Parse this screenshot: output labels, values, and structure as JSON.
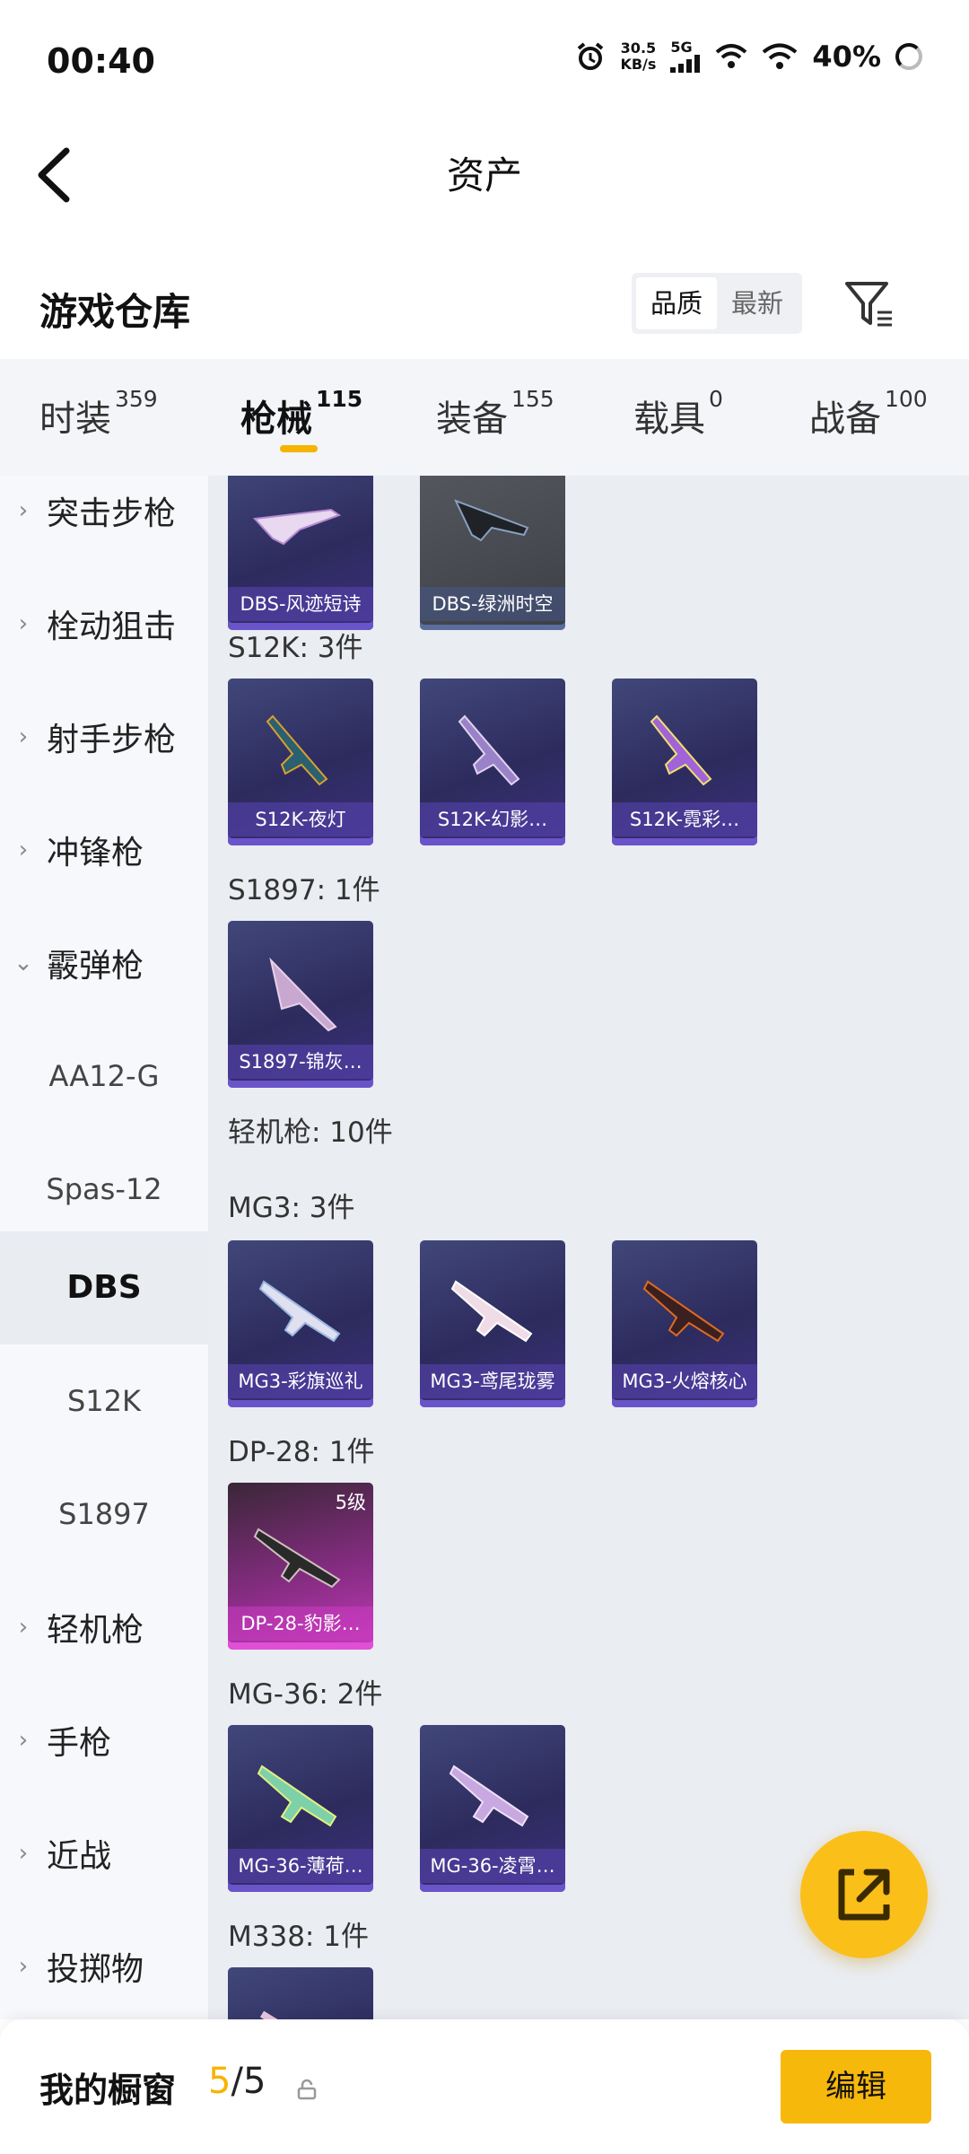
{
  "status_bar": {
    "time": "00:40",
    "net_speed_top": "30.5",
    "net_speed_unit": "KB/s",
    "signal_label": "5G",
    "battery": "40%"
  },
  "header": {
    "title": "资产"
  },
  "warehouse": {
    "title": "游戏仓库",
    "sort_options": [
      "品质",
      "最新"
    ],
    "active_sort": "品质"
  },
  "tabs": [
    {
      "label": "时装",
      "count": "359"
    },
    {
      "label": "枪械",
      "count": "115",
      "active": true
    },
    {
      "label": "装备",
      "count": "155"
    },
    {
      "label": "载具",
      "count": "0"
    },
    {
      "label": "战备",
      "count": "100"
    }
  ],
  "sidebar": {
    "categories": [
      "突击步枪",
      "栓动狙击",
      "射手步枪",
      "冲锋枪",
      "霰弹枪",
      "轻机枪",
      "手枪",
      "近战",
      "投掷物"
    ],
    "expanded": "霰弹枪",
    "subitems": [
      "AA12-G",
      "Spas-12",
      "DBS",
      "S12K",
      "S1897"
    ],
    "active_sub": "DBS"
  },
  "content": {
    "groups": [
      {
        "label": "",
        "items": [
          "DBS-风迹短诗",
          "DBS-绿洲时空"
        ]
      },
      {
        "label": "S12K: 3件",
        "items": [
          "S12K-夜灯",
          "S12K-幻影…",
          "S12K-霓彩…"
        ]
      },
      {
        "label": "S1897: 1件",
        "items": [
          "S1897-锦灰…"
        ]
      },
      {
        "label": "轻机枪: 10件",
        "items": []
      },
      {
        "label": "MG3: 3件",
        "items": [
          "MG3-彩旗巡礼",
          "MG3-鸢尾珑雾",
          "MG3-火熔核心"
        ]
      },
      {
        "label": "DP-28: 1件",
        "items": [
          "DP-28-豹影…"
        ],
        "level": "5级"
      },
      {
        "label": "MG-36: 2件",
        "items": [
          "MG-36-薄荷…",
          "MG-36-凌霄…"
        ]
      },
      {
        "label": "M338: 1件",
        "items": []
      }
    ]
  },
  "bottom_bar": {
    "label": "我的橱窗",
    "current": "5",
    "separator": "/",
    "total": "5",
    "edit_label": "编辑"
  },
  "colors": {
    "accent": "#f5b400",
    "card_purple": "#2d2b5e",
    "card_pink": "#c13bb8"
  }
}
